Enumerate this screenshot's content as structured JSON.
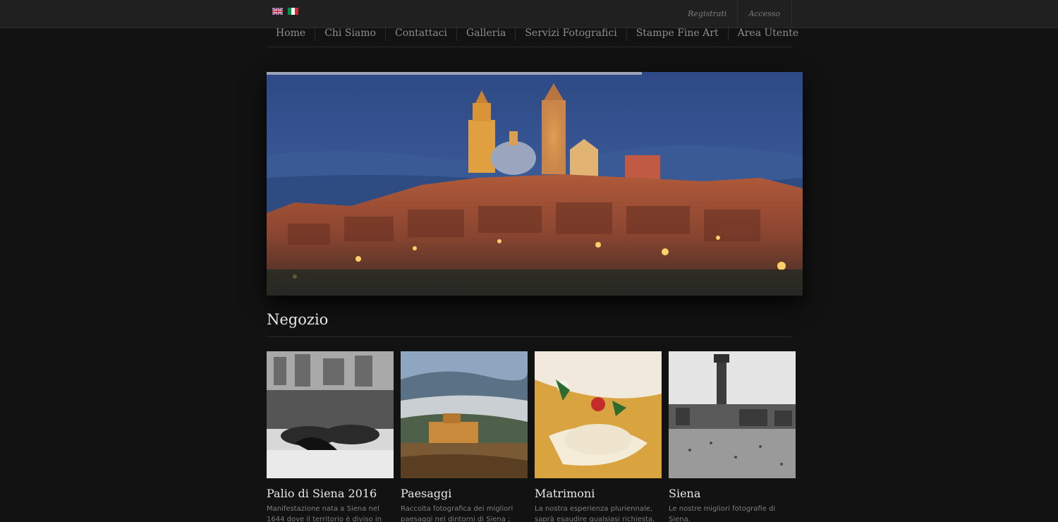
{
  "topbar": {
    "languages": [
      {
        "icon": "uk-flag-icon",
        "label": "English"
      },
      {
        "icon": "italy-flag-icon",
        "label": "Italiano"
      }
    ],
    "register_label": "Registrati",
    "login_label": "Accesso"
  },
  "nav": {
    "items": [
      "Home",
      "Chi Siamo",
      "Contattaci",
      "Galleria",
      "Servizi Fotografici",
      "Stampe Fine Art",
      "Area Utente"
    ]
  },
  "slider": {
    "progress": 0.7
  },
  "shop": {
    "title": "Negozio",
    "products": [
      {
        "title": "Palio di Siena 2016",
        "description": "Manifestazione nata a Siena nel 1644 dove il territorio è diviso in diciassette"
      },
      {
        "title": "Paesaggi",
        "description": "Raccolta fotografica dei migliori paesaggi nei dintorni di Siena ;"
      },
      {
        "title": "Matrimoni",
        "description": "La nostra esperienza pluriennale, saprà esaudire qualsiasi richiesta, per"
      },
      {
        "title": "Siena",
        "description": "Le nostre migliori fotografie di Siena."
      }
    ]
  },
  "colors": {
    "background": "#121212",
    "topbar": "#202020",
    "nav_text": "#8e8e8e",
    "progress_bar": "#9da3b8"
  }
}
